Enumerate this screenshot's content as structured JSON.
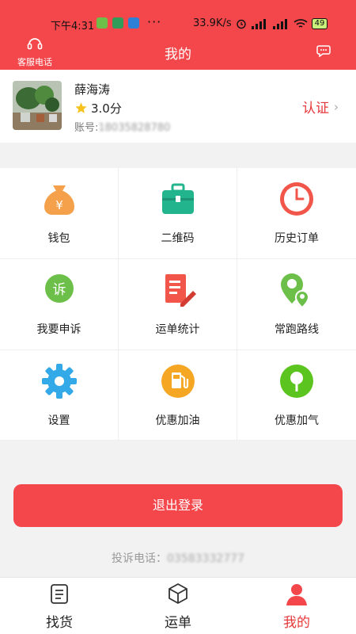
{
  "status_bar": {
    "time": "下午4:31",
    "dots": "···",
    "speed": "33.9K/s",
    "battery": "49"
  },
  "header": {
    "title": "我的",
    "service_label": "客服电话"
  },
  "profile": {
    "name": "薛海涛",
    "rating": "3.0分",
    "account_label": "账号:",
    "account_number": "18035828780",
    "certify_label": "认证",
    "certify_arrow": "›"
  },
  "menu": [
    {
      "label": "钱包",
      "icon": "wallet-icon",
      "color": "#f5a04a"
    },
    {
      "label": "二维码",
      "icon": "briefcase-icon",
      "color": "#22b48c"
    },
    {
      "label": "历史订单",
      "icon": "clock-icon",
      "color": "#f2564a"
    },
    {
      "label": "我要申诉",
      "icon": "complaint-icon",
      "color": "#6cc04a"
    },
    {
      "label": "运单统计",
      "icon": "document-edit-icon",
      "color": "#f2564a"
    },
    {
      "label": "常跑路线",
      "icon": "route-pin-icon",
      "color": "#6cc04a"
    },
    {
      "label": "设置",
      "icon": "gear-icon",
      "color": "#33a9e8"
    },
    {
      "label": "优惠加油",
      "icon": "fuel-icon",
      "color": "#f5a623"
    },
    {
      "label": "优惠加气",
      "icon": "gas-pin-icon",
      "color": "#5cc41e"
    }
  ],
  "complaint_icon_text": "诉",
  "logout_label": "退出登录",
  "complaint_phone": {
    "label": "投诉电话：",
    "number": "03583332777"
  },
  "tabs": [
    {
      "label": "找货",
      "icon": "clipboard-icon"
    },
    {
      "label": "运单",
      "icon": "cube-icon"
    },
    {
      "label": "我的",
      "icon": "user-icon"
    }
  ],
  "colors": {
    "brand": "#f4474b",
    "accent_text": "#e7383b"
  }
}
